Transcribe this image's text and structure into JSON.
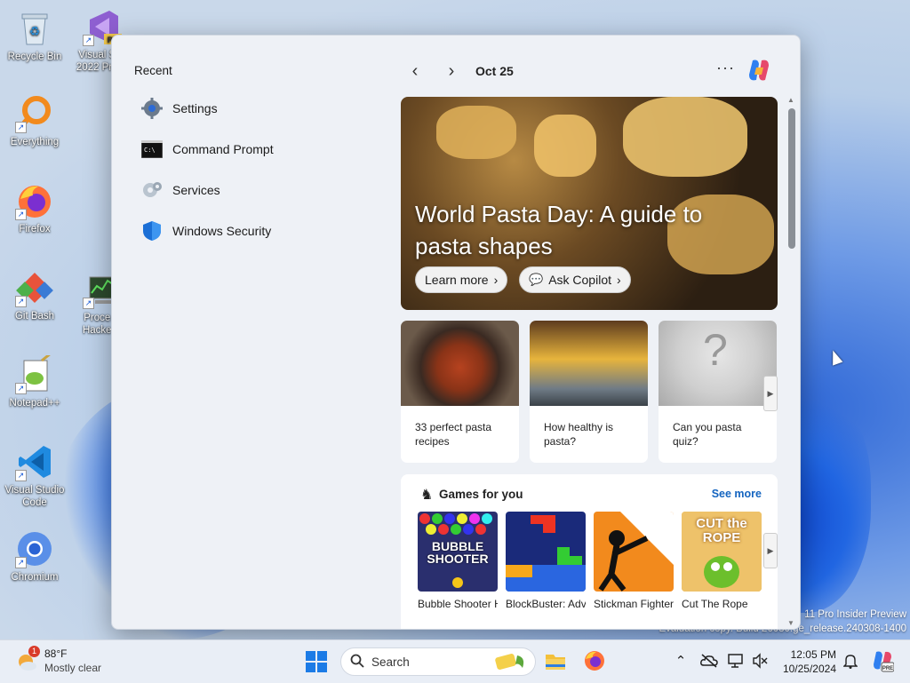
{
  "desktop": {
    "icons": [
      {
        "label": "Recycle Bin"
      },
      {
        "label": "Visual S… 2022 Pre…"
      },
      {
        "label": "Everything"
      },
      {
        "label": "Firefox"
      },
      {
        "label": "Git Bash"
      },
      {
        "label": "Proce… Hacke…"
      },
      {
        "label": "Notepad++"
      },
      {
        "label": "Visual Studio Code"
      },
      {
        "label": "Chromium"
      }
    ],
    "watermark": {
      "line1": "11 Pro Insider Preview",
      "line2": "Evaluation copy. Build 26080.ge_release.240308-1400"
    }
  },
  "start_panel": {
    "recent_title": "Recent",
    "recent_items": [
      {
        "label": "Settings",
        "icon": "gear-icon"
      },
      {
        "label": "Command Prompt",
        "icon": "terminal-icon"
      },
      {
        "label": "Services",
        "icon": "services-gear-icon"
      },
      {
        "label": "Windows Security",
        "icon": "shield-icon"
      }
    ],
    "date": "Oct 25",
    "more_label": "···",
    "hero": {
      "title": "World Pasta Day: A guide to pasta shapes",
      "learn_more": "Learn more",
      "ask_copilot": "Ask Copilot"
    },
    "cards": [
      {
        "caption": "33 perfect pasta recipes"
      },
      {
        "caption": "How healthy is pasta?"
      },
      {
        "caption": "Can you pasta quiz?"
      }
    ],
    "games": {
      "title": "Games for you",
      "see_more": "See more",
      "items": [
        {
          "caption": "Bubble Shooter HD",
          "art_text": "BUBBLE SHOOTER"
        },
        {
          "caption": "BlockBuster: Adventures …",
          "art_text": ""
        },
        {
          "caption": "Stickman Fighter : Mega…",
          "art_text": ""
        },
        {
          "caption": "Cut The Rope",
          "art_text": "CUT the ROPE"
        }
      ]
    }
  },
  "taskbar": {
    "weather": {
      "temp": "88°F",
      "desc": "Mostly clear",
      "badge": "1"
    },
    "search_label": "Search",
    "time": "12:05 PM",
    "date": "10/25/2024"
  }
}
